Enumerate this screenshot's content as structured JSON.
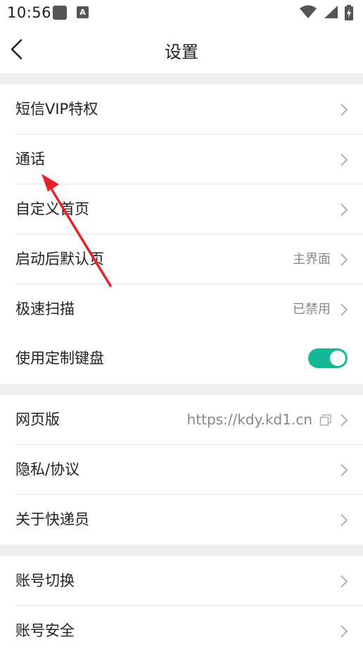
{
  "status_bar": {
    "time": "10:56",
    "notif_a": "A"
  },
  "header": {
    "title": "设置"
  },
  "colors": {
    "accent": "#14b894",
    "annotation_arrow": "#e8202a",
    "section_gap": "#f0f0f0"
  },
  "section1": {
    "items": [
      {
        "label": "短信VIP特权",
        "value": ""
      },
      {
        "label": "通话",
        "value": ""
      },
      {
        "label": "自定义首页",
        "value": ""
      },
      {
        "label": "启动后默认页",
        "value": "主界面"
      },
      {
        "label": "极速扫描",
        "value": "已禁用"
      },
      {
        "label": "使用定制键盘",
        "toggle_on": true
      }
    ]
  },
  "section2": {
    "items": [
      {
        "label": "网页版",
        "value": "https://kdy.kd1.cn"
      },
      {
        "label": "隐私/协议",
        "value": ""
      },
      {
        "label": "关于快递员",
        "value": ""
      }
    ]
  },
  "section3": {
    "items": [
      {
        "label": "账号切换",
        "value": ""
      },
      {
        "label": "账号安全",
        "value": ""
      }
    ]
  }
}
